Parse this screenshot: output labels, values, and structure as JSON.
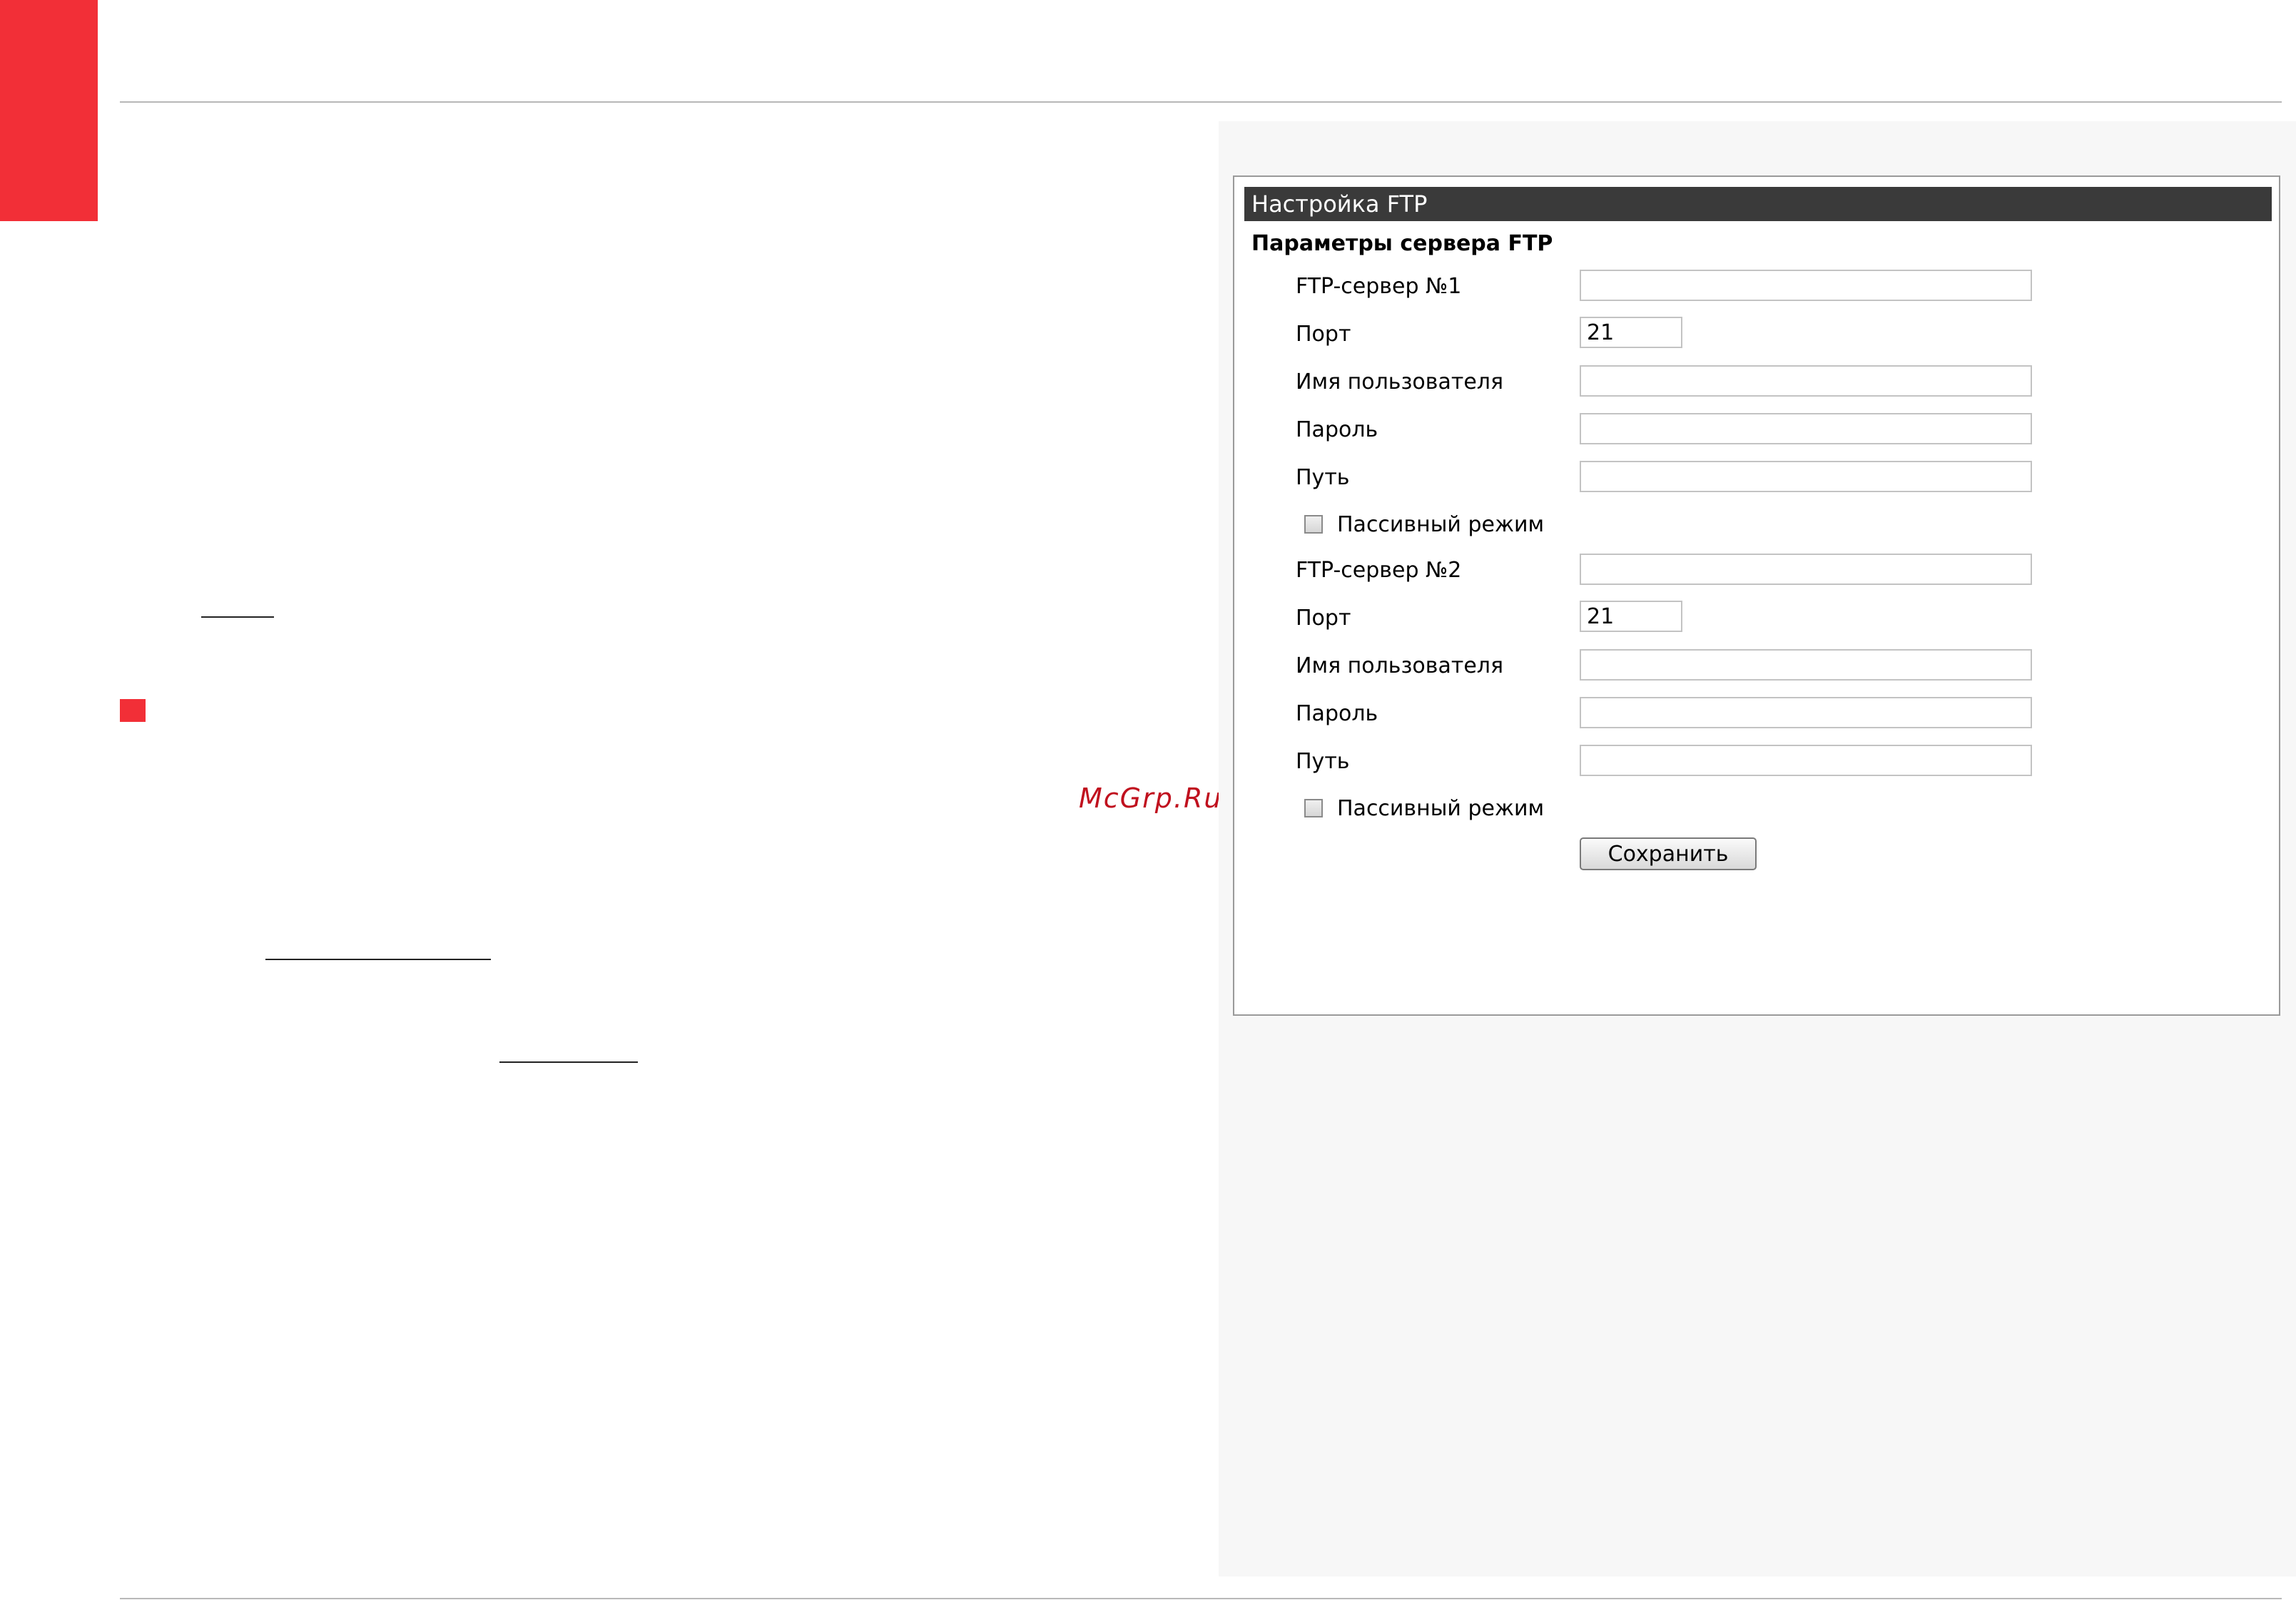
{
  "watermark": "McGrp.Ru",
  "ftp_panel": {
    "title": "Настройка FTP",
    "section_heading": "Параметры сервера FTP",
    "server1": {
      "server_label": "FTP-сервер №1",
      "server_value": "",
      "port_label": "Порт",
      "port_value": "21",
      "username_label": "Имя пользователя",
      "username_value": "",
      "password_label": "Пароль",
      "password_value": "",
      "path_label": "Путь",
      "path_value": "",
      "passive_label": "Пассивный режим",
      "passive_checked": false
    },
    "server2": {
      "server_label": "FTP-сервер №2",
      "server_value": "",
      "port_label": "Порт",
      "port_value": "21",
      "username_label": "Имя пользователя",
      "username_value": "",
      "password_label": "Пароль",
      "password_value": "",
      "path_label": "Путь",
      "path_value": "",
      "passive_label": "Пассивный режим",
      "passive_checked": false
    },
    "save_label": "Сохранить"
  },
  "colors": {
    "accent_red": "#f22f37",
    "titlebar": "#3a3a3a",
    "watermark": "#c0101e"
  }
}
